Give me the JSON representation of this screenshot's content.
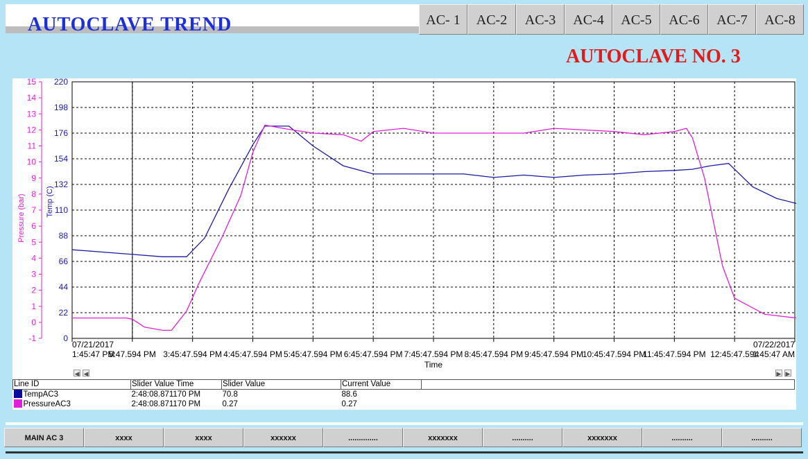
{
  "header": {
    "title": "AUTOCLAVE  TREND",
    "subtitle": "AUTOCLAVE NO. 3"
  },
  "tabs": [
    "AC- 1",
    "AC-2",
    "AC-3",
    "AC-4",
    "AC-5",
    "AC-6",
    "AC-7",
    "AC-8"
  ],
  "chart_data": {
    "type": "line",
    "xlabel": "Time",
    "y_left_outer": {
      "label": "Pressure (bar)",
      "ticks": [
        "15",
        "14",
        "13",
        "12",
        "11",
        "10",
        "9",
        "8",
        "7",
        "6",
        "5",
        "4",
        "3",
        "2",
        "1",
        "0",
        "-1"
      ],
      "color": "#e020d8"
    },
    "y_left_inner": {
      "label": "Temp (C)",
      "ticks": [
        "220",
        "198",
        "176",
        "154",
        "132",
        "110",
        "88",
        "66",
        "44",
        "22",
        "0"
      ],
      "color": "#1a1aa8"
    },
    "x_dates": {
      "start": "07/21/2017",
      "end": "07/22/2017"
    },
    "x_ticks": [
      "1:45:47 PM",
      "5:47.594 PM",
      "3:45:47.594 PM",
      "4:45:47.594 PM",
      "5:45:47.594 PM",
      "6:45:47.594 PM",
      "7:45:47.594 PM",
      "8:45:47.594 PM",
      "9:45:47.594 PM",
      "10:45:47.594 PM",
      "11:45:47.594 PM",
      "12:45:47.594",
      "1:45:47 AM"
    ],
    "grid": true,
    "series": [
      {
        "name": "TempAC3",
        "color": "#1a1aa8",
        "axis": "temp",
        "x": [
          0,
          0.5,
          1,
          1.5,
          1.9,
          2.2,
          2.6,
          3,
          3.2,
          3.6,
          4,
          4.5,
          5,
          5.5,
          6,
          6.5,
          7,
          7.5,
          8,
          8.5,
          9,
          9.5,
          10,
          10.3,
          10.6,
          10.9,
          11.3,
          11.7,
          12,
          12.4,
          12.7,
          13
        ],
        "values": [
          76,
          74,
          72,
          70,
          70,
          86,
          128,
          166,
          182,
          182,
          165,
          148,
          141,
          141,
          141,
          141,
          138,
          140,
          138,
          140,
          141,
          143,
          144,
          145,
          148,
          150,
          130,
          120,
          116,
          112,
          110,
          103
        ]
      },
      {
        "name": "PressureAC3",
        "color": "#e020d8",
        "axis": "pressure",
        "x": [
          0,
          0.5,
          0.9,
          1,
          1.2,
          1.5,
          1.65,
          1.9,
          2.1,
          2.5,
          2.8,
          3,
          3.2,
          3.5,
          4,
          4.5,
          4.8,
          5,
          5.5,
          6,
          6.5,
          7,
          7.5,
          8,
          8.5,
          9,
          9.5,
          10,
          10.2,
          10.3,
          10.5,
          10.8,
          11,
          11.5,
          12,
          12.5,
          13
        ],
        "values": [
          0.27,
          0.27,
          0.27,
          0.2,
          -0.3,
          -0.5,
          -0.5,
          0.7,
          2.4,
          5.4,
          7.9,
          10.6,
          12.3,
          12.1,
          11.8,
          11.7,
          11.3,
          11.9,
          12.1,
          11.8,
          11.8,
          11.8,
          11.8,
          12.1,
          12.0,
          11.9,
          11.7,
          11.9,
          12.1,
          11.5,
          9,
          3.5,
          1.5,
          0.5,
          0.28,
          0.27,
          0.27
        ]
      }
    ]
  },
  "legend": {
    "headers": [
      "Line ID",
      "Slider Value Time",
      "Slider Value",
      "Current Value",
      ""
    ],
    "rows": [
      {
        "id": "TempAC3",
        "time": "2:48:08.871170 PM",
        "slider": "70.8",
        "current": "88.6",
        "color": "#0a0a9c"
      },
      {
        "id": "PressureAC3",
        "time": "2:48:08.871170 PM",
        "slider": "0.27",
        "current": "0.27",
        "color": "#e020d8"
      }
    ]
  },
  "bottom_nav": [
    "MAIN AC 3",
    "xxxx",
    "xxxx",
    "xxxxxx",
    "..............",
    "xxxxxxx",
    "..........",
    "xxxxxxx",
    "..........",
    ".........."
  ]
}
